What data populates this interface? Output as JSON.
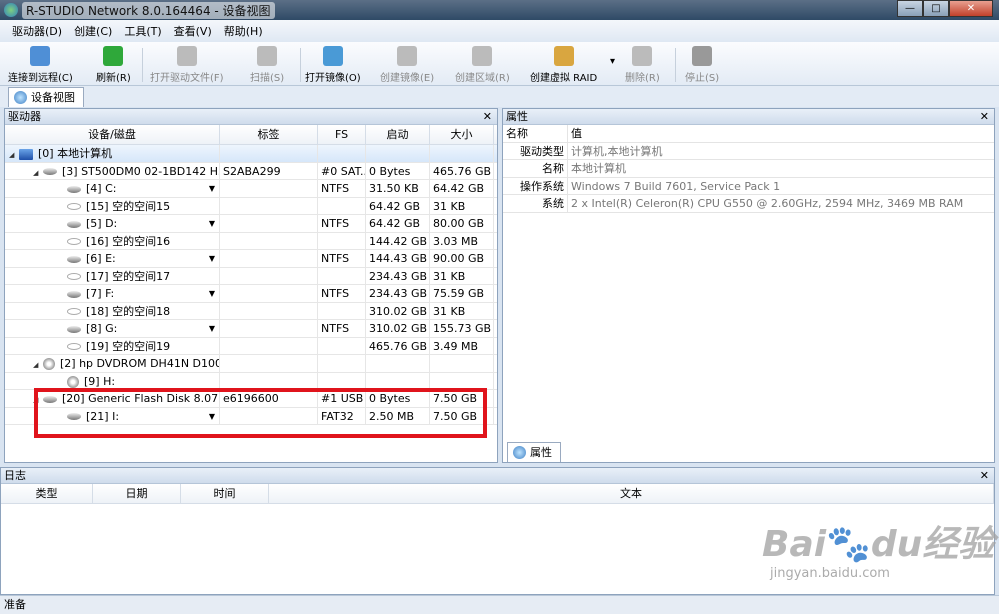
{
  "window": {
    "title": "R-STUDIO Network 8.0.164464 - 设备视图",
    "min": "—",
    "max": "□",
    "close": "✕"
  },
  "menu": [
    "驱动器(D)",
    "创建(C)",
    "工具(T)",
    "查看(V)",
    "帮助(H)"
  ],
  "toolbar": [
    {
      "label": "连接到远程(C)",
      "icon": "connect-remote-icon",
      "enabled": true,
      "color": "#4f8fd6"
    },
    {
      "label": "刷新(R)",
      "icon": "refresh-icon",
      "enabled": true,
      "color": "#2fa83a"
    },
    {
      "label": "打开驱动文件(F)",
      "icon": "open-drive-files-icon",
      "enabled": false,
      "color": "#bbbbbb"
    },
    {
      "label": "扫描(S)",
      "icon": "scan-icon",
      "enabled": false,
      "color": "#bbbbbb"
    },
    {
      "label": "打开镜像(O)",
      "icon": "open-image-icon",
      "enabled": true,
      "color": "#4a9ad6"
    },
    {
      "label": "创建镜像(E)",
      "icon": "create-image-icon",
      "enabled": false,
      "color": "#bbbbbb"
    },
    {
      "label": "创建区域(R)",
      "icon": "create-region-icon",
      "enabled": false,
      "color": "#bbbbbb"
    },
    {
      "label": "创建虚拟 RAID",
      "icon": "create-raid-icon",
      "enabled": true,
      "color": "#d9a640"
    },
    {
      "label": "删除(R)",
      "icon": "delete-icon",
      "enabled": false,
      "color": "#bbbbbb"
    },
    {
      "label": "停止(S)",
      "icon": "stop-icon",
      "enabled": false,
      "color": "#999999"
    }
  ],
  "tab": "设备视图",
  "drives": {
    "title": "驱动器",
    "columns": [
      "设备/磁盘",
      "标签",
      "FS",
      "启动",
      "大小"
    ],
    "rows": [
      {
        "level": 0,
        "icon": "pc",
        "expand": "◢",
        "name": "[0] 本地计算机",
        "label": "",
        "fs": "",
        "start": "",
        "size": "",
        "selected": true
      },
      {
        "level": 1,
        "icon": "disk",
        "expand": "◢",
        "name": "[3] ST500DM0 02-1BD142 H...",
        "label": "S2ABA299",
        "fs": "#0 SAT...",
        "start": "0 Bytes",
        "size": "465.76 GB"
      },
      {
        "level": 2,
        "icon": "disk",
        "dropdown": true,
        "name": "[4] C:",
        "label": "",
        "fs": "NTFS",
        "start": "31.50 KB",
        "size": "64.42 GB"
      },
      {
        "level": 2,
        "icon": "empty",
        "name": "[15] 空的空间15",
        "label": "",
        "fs": "",
        "start": "64.42 GB",
        "size": "31 KB"
      },
      {
        "level": 2,
        "icon": "disk",
        "dropdown": true,
        "name": "[5] D:",
        "label": "",
        "fs": "NTFS",
        "start": "64.42 GB",
        "size": "80.00 GB"
      },
      {
        "level": 2,
        "icon": "empty",
        "name": "[16] 空的空间16",
        "label": "",
        "fs": "",
        "start": "144.42 GB",
        "size": "3.03 MB"
      },
      {
        "level": 2,
        "icon": "disk",
        "dropdown": true,
        "name": "[6] E:",
        "label": "",
        "fs": "NTFS",
        "start": "144.43 GB",
        "size": "90.00 GB"
      },
      {
        "level": 2,
        "icon": "empty",
        "name": "[17] 空的空间17",
        "label": "",
        "fs": "",
        "start": "234.43 GB",
        "size": "31 KB"
      },
      {
        "level": 2,
        "icon": "disk",
        "dropdown": true,
        "name": "[7] F:",
        "label": "",
        "fs": "NTFS",
        "start": "234.43 GB",
        "size": "75.59 GB"
      },
      {
        "level": 2,
        "icon": "empty",
        "name": "[18] 空的空间18",
        "label": "",
        "fs": "",
        "start": "310.02 GB",
        "size": "31 KB"
      },
      {
        "level": 2,
        "icon": "disk",
        "dropdown": true,
        "name": "[8] G:",
        "label": "",
        "fs": "NTFS",
        "start": "310.02 GB",
        "size": "155.73 GB"
      },
      {
        "level": 2,
        "icon": "empty",
        "name": "[19] 空的空间19",
        "label": "",
        "fs": "",
        "start": "465.76 GB",
        "size": "3.49 MB"
      },
      {
        "level": 1,
        "icon": "cd",
        "expand": "◢",
        "name": "[2] hp DVDROM DH41N D100",
        "label": "",
        "fs": "",
        "start": "",
        "size": ""
      },
      {
        "level": 2,
        "icon": "cd",
        "name": "[9] H:",
        "label": "",
        "fs": "",
        "start": "",
        "size": ""
      },
      {
        "level": 1,
        "icon": "disk",
        "expand": "◢",
        "name": "[20] Generic Flash Disk 8.07",
        "label": "e6196600",
        "fs": "#1 USB",
        "start": "0 Bytes",
        "size": "7.50 GB"
      },
      {
        "level": 2,
        "icon": "disk",
        "dropdown": true,
        "name": "[21] I:",
        "label": "",
        "fs": "FAT32",
        "start": "2.50 MB",
        "size": "7.50 GB"
      }
    ]
  },
  "properties": {
    "title": "属性",
    "columns": [
      "名称",
      "值"
    ],
    "rows": [
      {
        "name": "驱动类型",
        "value": "计算机,本地计算机"
      },
      {
        "name": "名称",
        "value": "本地计算机"
      },
      {
        "name": "操作系统",
        "value": "Windows 7 Build 7601, Service Pack 1"
      },
      {
        "name": "系统",
        "value": "2 x Intel(R) Celeron(R) CPU G550 @ 2.60GHz, 2594 MHz, 3469 MB RAM"
      }
    ],
    "tab": "属性"
  },
  "log": {
    "title": "日志",
    "columns": [
      "类型",
      "日期",
      "时间",
      "文本"
    ]
  },
  "status": "准备",
  "watermark": {
    "logo": "Baidu经验",
    "url": "jingyan.baidu.com"
  },
  "close_glyph": "✕"
}
